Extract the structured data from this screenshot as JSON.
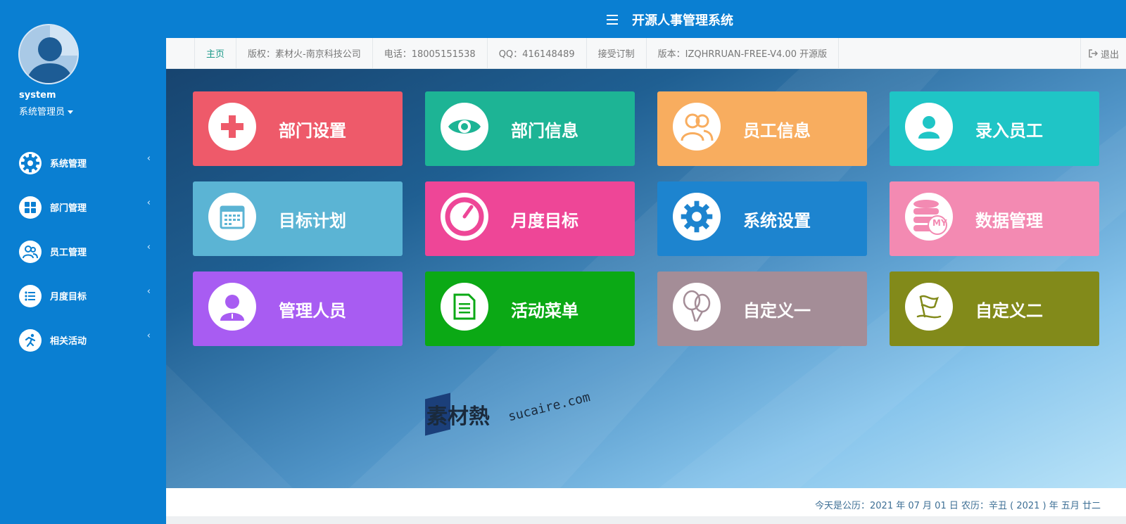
{
  "app": {
    "title": "开源人事管理系统"
  },
  "user": {
    "name": "system",
    "role": "系统管理员"
  },
  "sidebar": {
    "items": [
      {
        "label": "系统管理",
        "icon": "gear-icon"
      },
      {
        "label": "部门管理",
        "icon": "grid-icon"
      },
      {
        "label": "员工管理",
        "icon": "users-icon"
      },
      {
        "label": "月度目标",
        "icon": "list-icon"
      },
      {
        "label": "相关活动",
        "icon": "runner-icon"
      }
    ]
  },
  "infobar": {
    "home": "主页",
    "copyright": "版权：素材火-南京科技公司",
    "phone": "电话：18005151538",
    "qq": "QQ：416148489",
    "custom": "接受订制",
    "version": "版本：IZQHRRUAN-FREE-V4.00 开源版",
    "logout": "退出"
  },
  "tiles": [
    {
      "label": "部门设置",
      "icon": "plus-icon",
      "color": "#ee5a6a"
    },
    {
      "label": "部门信息",
      "icon": "eye-icon",
      "color": "#1db495"
    },
    {
      "label": "员工信息",
      "icon": "users-icon",
      "color": "#f8ad5f"
    },
    {
      "label": "录入员工",
      "icon": "user-icon",
      "color": "#1fc5c6"
    },
    {
      "label": "目标计划",
      "icon": "calendar-icon",
      "color": "#5bb4d4"
    },
    {
      "label": "月度目标",
      "icon": "gauge-icon",
      "color": "#ee4697"
    },
    {
      "label": "系统设置",
      "icon": "gear-icon",
      "color": "#1d84cf"
    },
    {
      "label": "数据管理",
      "icon": "database-icon",
      "color": "#f38ab2"
    },
    {
      "label": "管理人员",
      "icon": "manager-icon",
      "color": "#a85cf2"
    },
    {
      "label": "活动菜单",
      "icon": "document-icon",
      "color": "#0ba915"
    },
    {
      "label": "自定义一",
      "icon": "balloon-icon",
      "color": "#a48d97"
    },
    {
      "label": "自定义二",
      "icon": "flag-icon",
      "color": "#828a1a"
    }
  ],
  "watermark": {
    "cn": "素材熱",
    "en": "sucaire.com"
  },
  "footer": {
    "date": "今天是公历：2021 年 07 月 01 日   农历：辛丑 ( 2021 ) 年  五月 廿二"
  }
}
